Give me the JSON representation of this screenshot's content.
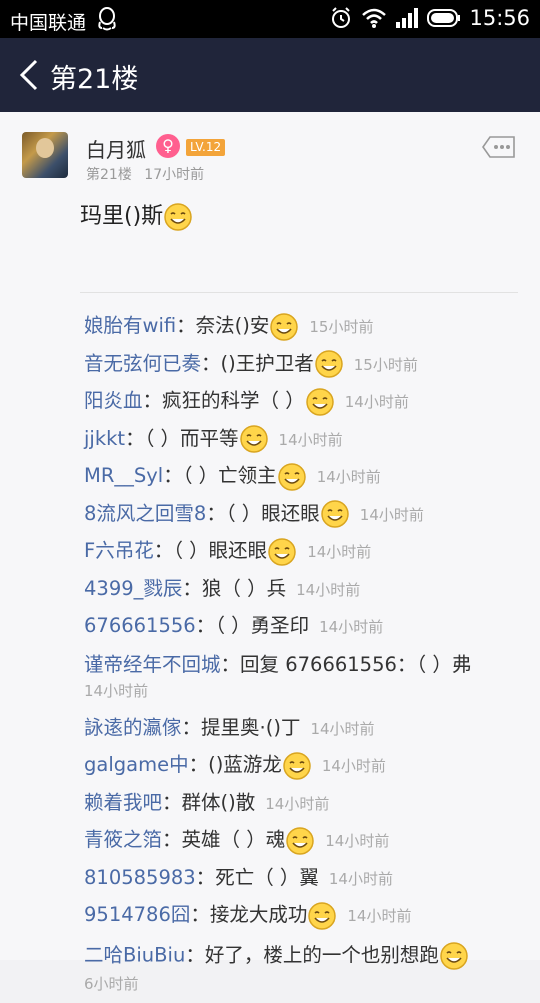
{
  "status": {
    "carrier": "中国联通",
    "time": "15:56"
  },
  "nav": {
    "title": "第21楼"
  },
  "post": {
    "username": "白月狐",
    "gender_symbol": "♀",
    "level": "LV.12",
    "floor": "第21楼",
    "time": "17小时前",
    "content": "玛里()斯"
  },
  "replies": [
    {
      "name": "娘胎有wifi",
      "sep": "：",
      "text": "奈法()安",
      "emoji": true,
      "time": "15小时前"
    },
    {
      "name": "音无弦何已奏",
      "sep": "：",
      "text": "()王护卫者",
      "emoji": true,
      "time": "15小时前"
    },
    {
      "name": "阳炎血",
      "sep": "：",
      "text": "疯狂的科学（ ）",
      "emoji": true,
      "time": "14小时前"
    },
    {
      "name": "jjkkt",
      "sep": "：",
      "text": "（ ）而平等",
      "emoji": true,
      "time": "14小时前"
    },
    {
      "name": "MR__Syl",
      "sep": "：",
      "text": "（ ）亡领主",
      "emoji": true,
      "time": "14小时前"
    },
    {
      "name": "8流风之回雪8",
      "sep": "：",
      "text": "（ ）眼还眼",
      "emoji": true,
      "time": "14小时前"
    },
    {
      "name": "F六吊花",
      "sep": "：",
      "text": "（ ）眼还眼",
      "emoji": true,
      "time": "14小时前"
    },
    {
      "name": "4399_戮辰",
      "sep": "：",
      "text": "狼（ ）兵",
      "emoji": false,
      "time": "14小时前"
    },
    {
      "name": "676661556",
      "sep": "：",
      "text": "（ ）勇圣印",
      "emoji": false,
      "time": "14小时前"
    },
    {
      "name": "谨帝经年不回城",
      "sep": "：",
      "text": "回复 676661556：（ ）弗",
      "emoji": false,
      "time": "14小时前"
    },
    {
      "name": "詠逺的瀛傢",
      "sep": "：",
      "text": "提里奥·()丁",
      "emoji": false,
      "time": "14小时前"
    },
    {
      "name": "galgame中",
      "sep": "：",
      "text": "()蓝游龙",
      "emoji": true,
      "time": "14小时前"
    },
    {
      "name": "赖着我吧",
      "sep": "：",
      "text": "群体()散",
      "emoji": false,
      "time": "14小时前"
    },
    {
      "name": "青筱之箔",
      "sep": "：",
      "text": "英雄（ ）魂",
      "emoji": true,
      "time": "14小时前"
    },
    {
      "name": "810585983",
      "sep": "：",
      "text": "死亡（ ）翼",
      "emoji": false,
      "time": "14小时前"
    },
    {
      "name": "9514786囧",
      "sep": "：",
      "text": "接龙大成功",
      "emoji": true,
      "time": "14小时前"
    },
    {
      "name": "二哈BiuBiu",
      "sep": "：",
      "text": "好了，楼上的一个也别想跑",
      "emoji": true,
      "time": "6小时前"
    }
  ]
}
